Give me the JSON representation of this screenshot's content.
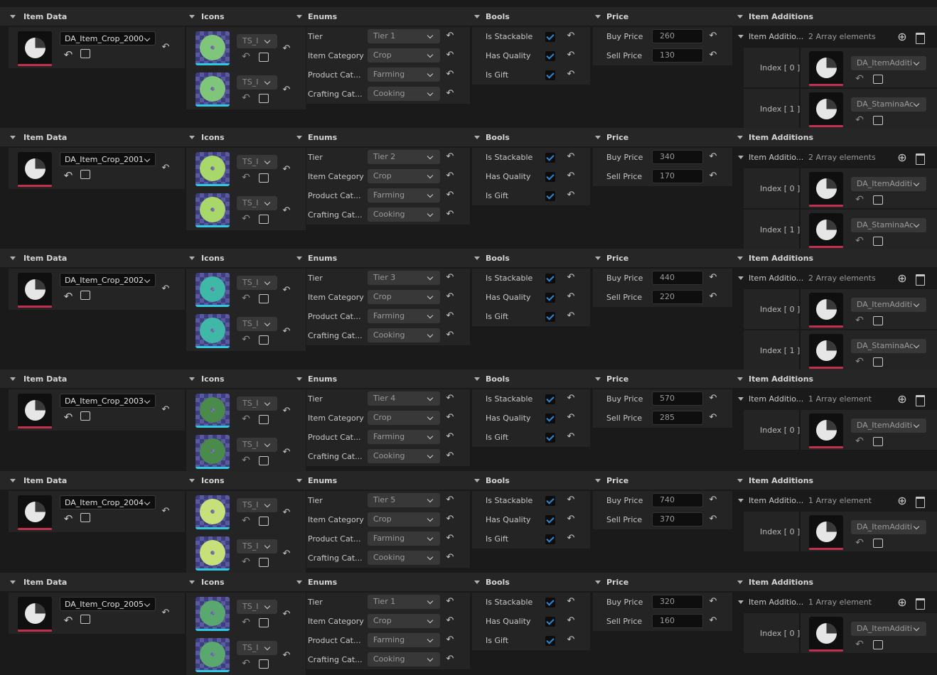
{
  "headers": {
    "item_data": "Item Data",
    "icons": "Icons",
    "enums": "Enums",
    "bools": "Bools",
    "price": "Price",
    "item_additions": "Item Additions"
  },
  "labels": {
    "tier": "Tier",
    "item_category": "Item Category",
    "product_cat": "Product Cat...",
    "crafting_cat": "Crafting Cat...",
    "is_stackable": "Is Stackable",
    "has_quality": "Has Quality",
    "is_gift": "Is Gift",
    "buy_price": "Buy Price",
    "sell_price": "Sell Price",
    "item_additio": "Item Additio...",
    "ts_label": "TS_I",
    "index0": "Index [ 0 ]",
    "index1": "Index [ 1 ]",
    "add_icon": "⊕",
    "delete_icon": "🗑",
    "reset_icon": "↶"
  },
  "colors": {
    "accent_checkbox": "#2a8ad8",
    "thumbnail_bar": "#c0304f",
    "texture_bar": "#2ec8e0"
  },
  "items": [
    {
      "asset": "DA_Item_Crop_2000",
      "tier": "Tier 1",
      "category": "Crop",
      "product": "Farming",
      "crafting": "Cooking",
      "is_stackable": true,
      "has_quality": true,
      "is_gift": true,
      "buy": "260",
      "sell": "130",
      "array_count": "2 Array elements",
      "additions": [
        "DA_ItemAdditi",
        "DA_StaminaAc"
      ],
      "plant_color": "#7fc67a"
    },
    {
      "asset": "DA_Item_Crop_2001",
      "tier": "Tier 2",
      "category": "Crop",
      "product": "Farming",
      "crafting": "Cooking",
      "is_stackable": true,
      "has_quality": true,
      "is_gift": true,
      "buy": "340",
      "sell": "170",
      "array_count": "2 Array elements",
      "additions": [
        "DA_ItemAdditi",
        "DA_StaminaAc"
      ],
      "plant_color": "#a9d86a"
    },
    {
      "asset": "DA_Item_Crop_2002",
      "tier": "Tier 3",
      "category": "Crop",
      "product": "Farming",
      "crafting": "Cooking",
      "is_stackable": true,
      "has_quality": true,
      "is_gift": true,
      "buy": "440",
      "sell": "220",
      "array_count": "2 Array elements",
      "additions": [
        "DA_ItemAdditi",
        "DA_StaminaAc"
      ],
      "plant_color": "#3fb8a8"
    },
    {
      "asset": "DA_Item_Crop_2003",
      "tier": "Tier 4",
      "category": "Crop",
      "product": "Farming",
      "crafting": "Cooking",
      "is_stackable": true,
      "has_quality": true,
      "is_gift": true,
      "buy": "570",
      "sell": "285",
      "array_count": "1 Array element",
      "additions": [
        "DA_ItemAdditi"
      ],
      "plant_color": "#4a8a4a"
    },
    {
      "asset": "DA_Item_Crop_2004",
      "tier": "Tier 5",
      "category": "Crop",
      "product": "Farming",
      "crafting": "Cooking",
      "is_stackable": true,
      "has_quality": true,
      "is_gift": true,
      "buy": "740",
      "sell": "370",
      "array_count": "1 Array element",
      "additions": [
        "DA_ItemAdditi"
      ],
      "plant_color": "#c8e07a"
    },
    {
      "asset": "DA_Item_Crop_2005",
      "tier": "Tier 1",
      "category": "Crop",
      "product": "Farming",
      "crafting": "Cooking",
      "is_stackable": true,
      "has_quality": true,
      "is_gift": true,
      "buy": "320",
      "sell": "160",
      "array_count": "1 Array element",
      "additions": [
        "DA_ItemAdditi"
      ],
      "plant_color": "#5aa870"
    }
  ]
}
